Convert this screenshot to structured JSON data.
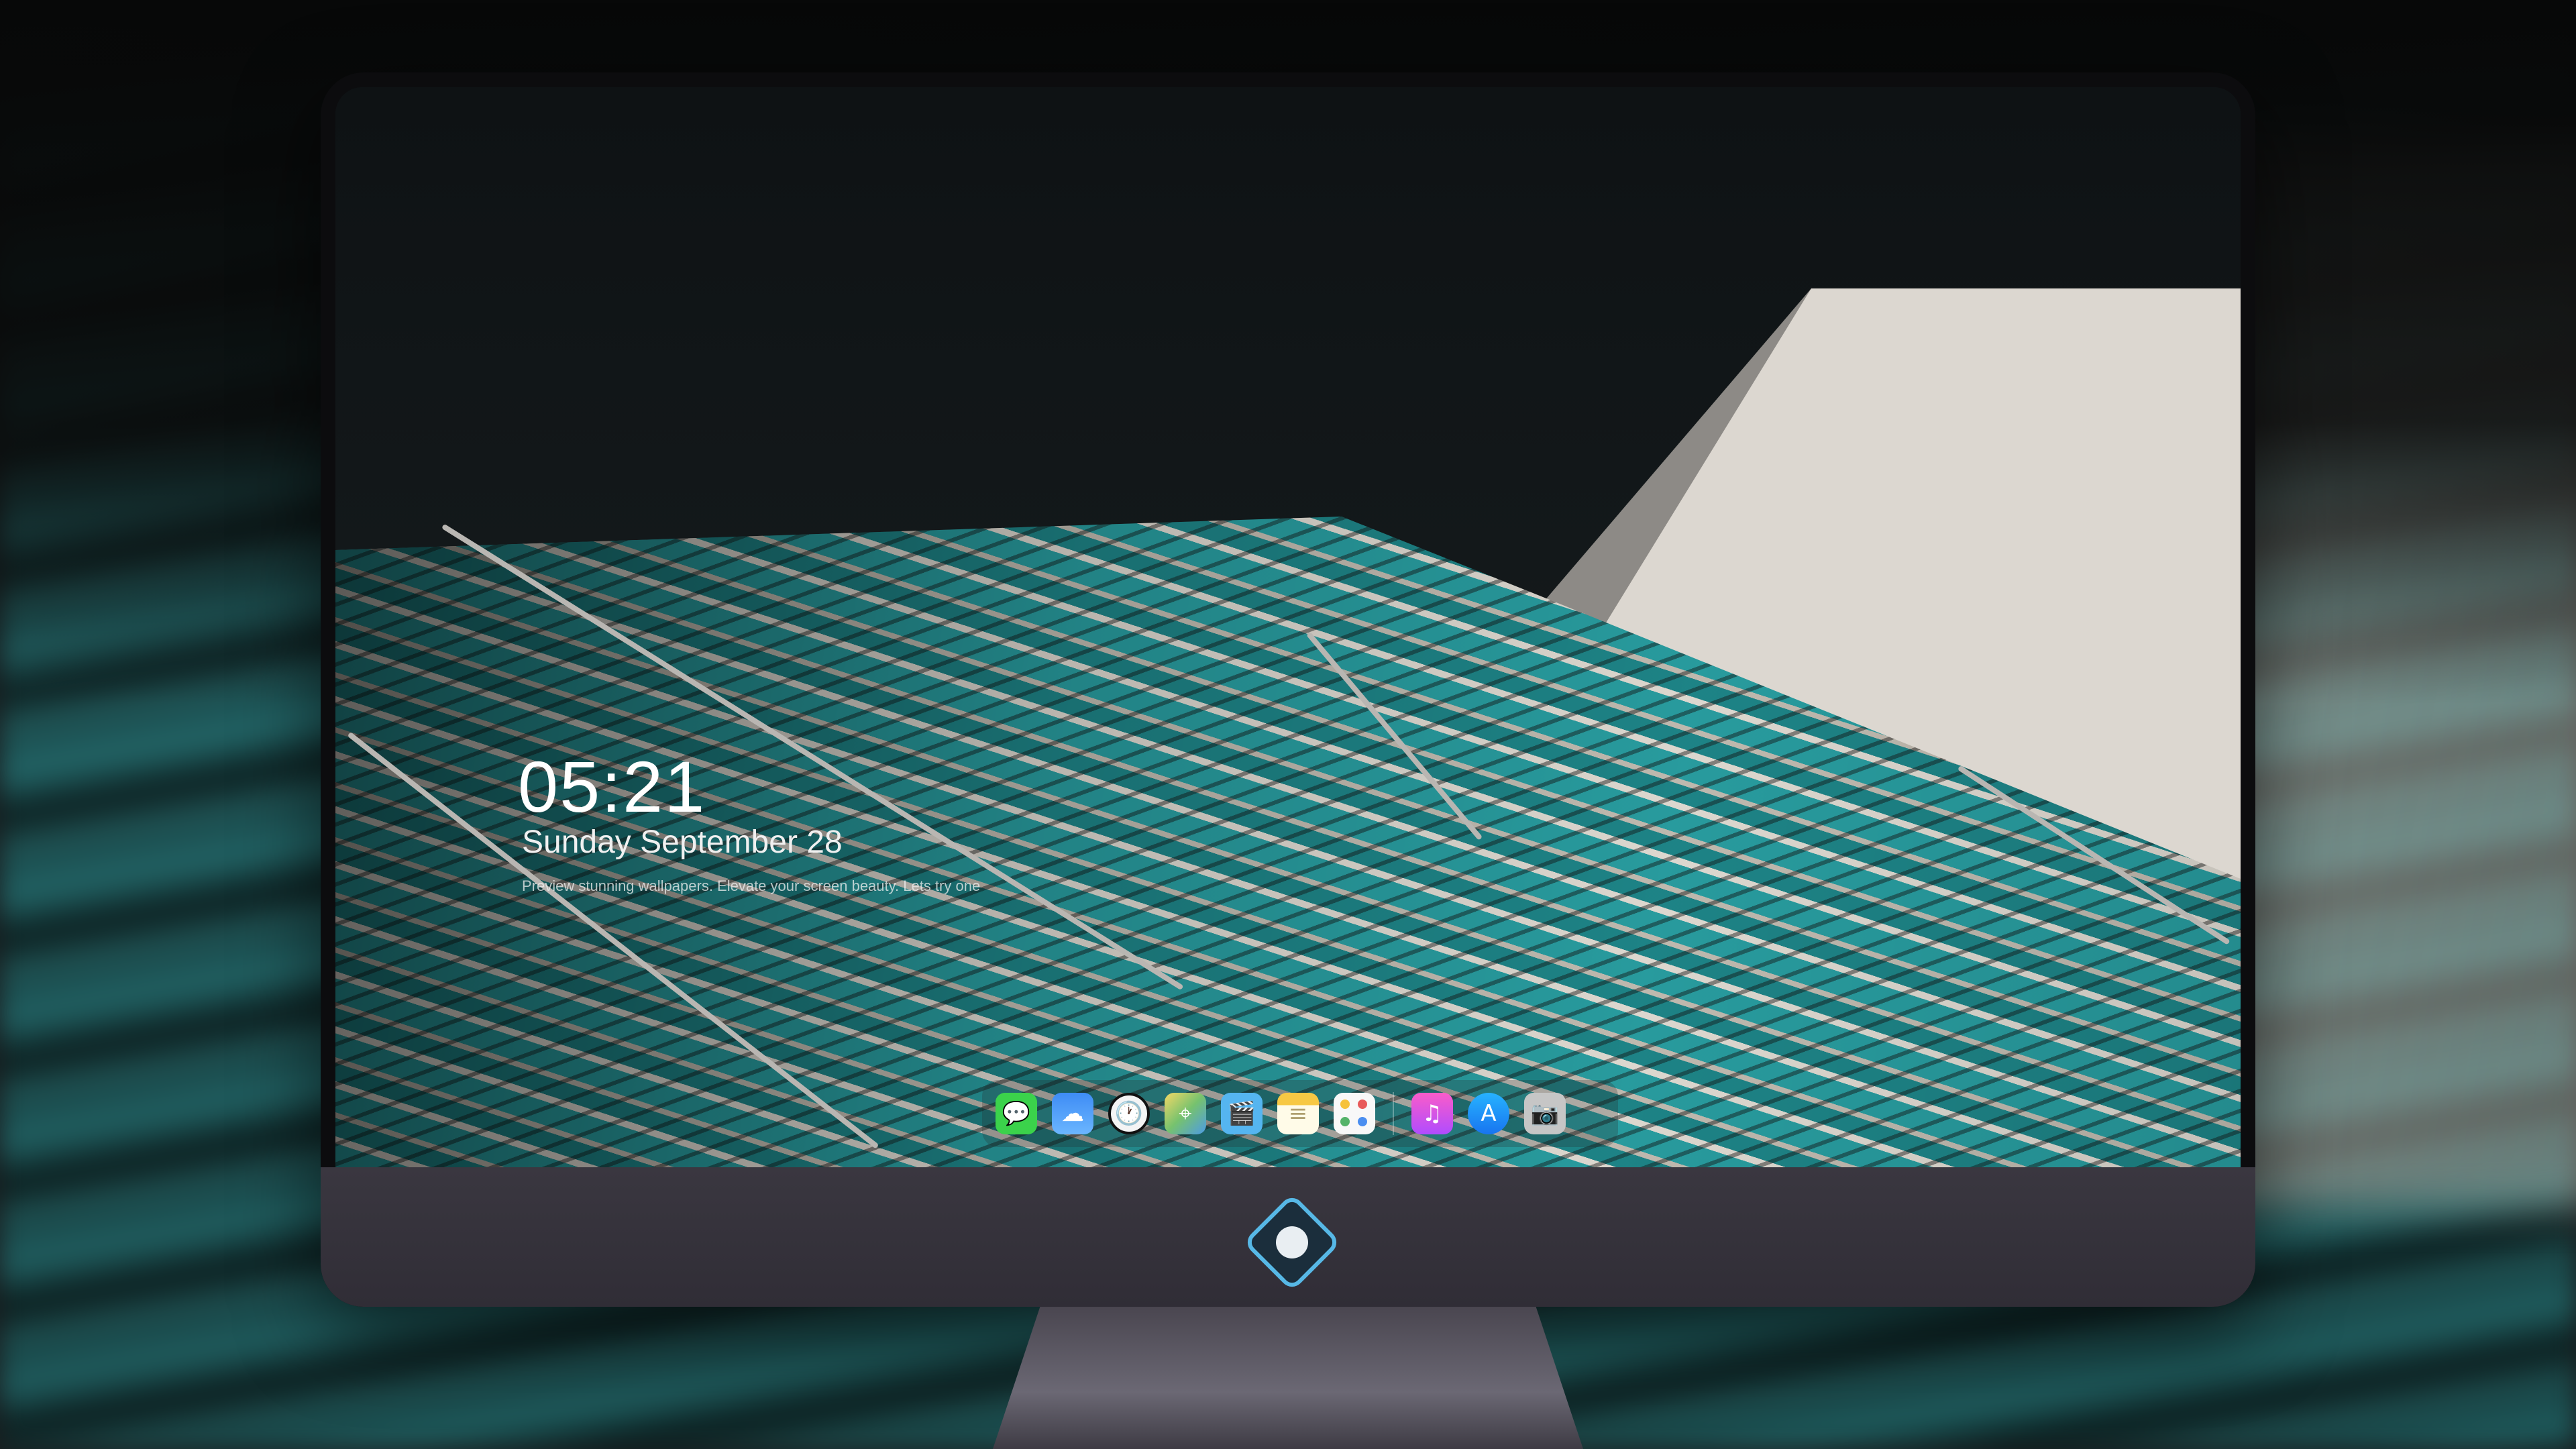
{
  "lockscreen": {
    "time": "05:21",
    "date": "Sunday September  28",
    "tagline": "Preview stunning wallpapers. Elevate your screen beauty. Lets try one"
  },
  "dock": {
    "apps": [
      {
        "name": "Messages",
        "icon": "messages-icon",
        "glyph": "💬"
      },
      {
        "name": "Weather",
        "icon": "weather-icon",
        "glyph": "☁"
      },
      {
        "name": "Clock",
        "icon": "clock-icon",
        "glyph": "🕐"
      },
      {
        "name": "Maps",
        "icon": "maps-icon",
        "glyph": "⌖"
      },
      {
        "name": "Clips",
        "icon": "clapperboard-icon",
        "glyph": "🎬"
      },
      {
        "name": "Notes",
        "icon": "notes-icon",
        "glyph": "≡"
      },
      {
        "name": "Photos",
        "icon": "photos-icon",
        "glyph": "✿"
      },
      {
        "name": "Music",
        "icon": "music-icon",
        "glyph": "♫"
      },
      {
        "name": "App Store",
        "icon": "app-store-icon",
        "glyph": "A"
      },
      {
        "name": "Camera",
        "icon": "camera-icon",
        "glyph": "📷"
      }
    ]
  },
  "colors": {
    "seat_teal": "#2aa3a6",
    "monitor_chin": "#3a3740",
    "logo_accent": "#57b8e6"
  }
}
